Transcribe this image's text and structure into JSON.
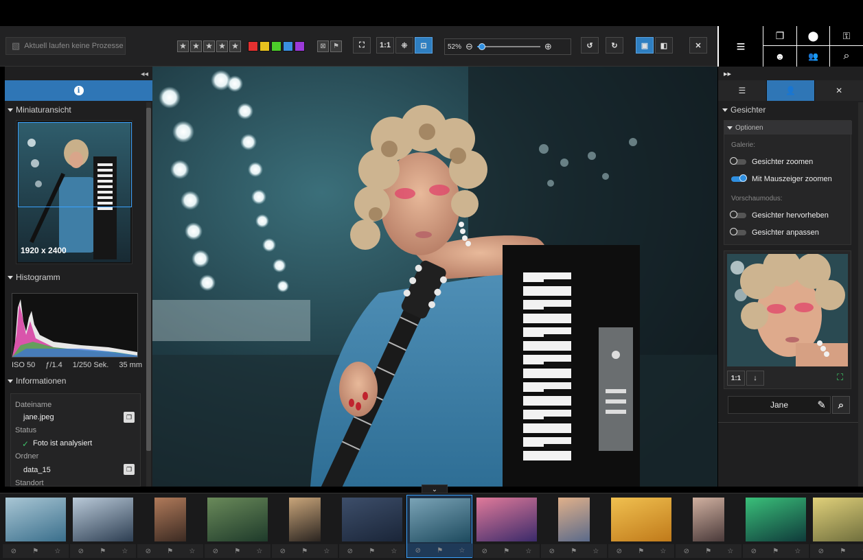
{
  "toolbar": {
    "status_text": "Aktuell laufen keine Prozesse",
    "rating_stars": [
      "★",
      "★",
      "★",
      "★",
      "★"
    ],
    "color_labels": [
      "#e53030",
      "#e8c21e",
      "#4ccd2a",
      "#3a8fe0",
      "#9b3ad8"
    ],
    "view_buttons": [
      "⛶",
      "1:1",
      "⁜",
      "⊡"
    ],
    "zoom_percent": "52%",
    "zoom_level": 0.08,
    "rotate_left": "↺",
    "rotate_right": "↻",
    "layout_single": "▣",
    "layout_compare": "◧",
    "close": "✕"
  },
  "right_cluster": {
    "menu_icon": "≡",
    "stack_icon": "❐",
    "location_icon": "⬤",
    "key_icon": "⚿",
    "face_icon": "☻",
    "people_icon": "👥",
    "search_icon": "⌕"
  },
  "left_panel": {
    "collapse_icon": "◂◂",
    "info_icon": "i",
    "thumbnail_header": "Miniaturansicht",
    "thumbnail_dims": "1920 x 2400",
    "histogram_header": "Histogramm",
    "exif": {
      "iso": "ISO 50",
      "aperture": "ƒ/1.4",
      "shutter": "1/250 Sek.",
      "focal": "35 mm"
    },
    "information_header": "Informationen",
    "info": {
      "filename_label": "Dateiname",
      "filename": "jane.jpeg",
      "status_label": "Status",
      "status_value": "Foto ist analysiert",
      "status_check": "✓",
      "folder_label": "Ordner",
      "folder": "data_15",
      "location_label": "Standort"
    }
  },
  "right_panel": {
    "collapse_icon": "▸▸",
    "tabs": [
      "☰",
      "👤",
      "✕"
    ],
    "faces_header": "Gesichter",
    "options_header": "Optionen",
    "gallery_label": "Galerie:",
    "preview_label": "Vorschaumodus:",
    "toggles": [
      {
        "label": "Gesichter zoomen",
        "on": false
      },
      {
        "label": "Mit Mauszeiger zoomen",
        "on": true
      },
      {
        "label": "Gesichter hervorheben",
        "on": false
      },
      {
        "label": "Gesichter anpassen",
        "on": false
      }
    ],
    "face_ctrl_1to1": "1:1",
    "face_ctrl_down": "↓",
    "face_ctrl_focus": "⛶",
    "person_name": "Jane",
    "edit_icon": "✎",
    "search_icon": "⌕"
  },
  "filmstrip": {
    "toggle_icon": "⌄",
    "bar_icons": [
      "⊘",
      "⚑",
      "☆"
    ],
    "thumbs": [
      {
        "c1": "#3a6f8c",
        "c2": "#a9c6d4"
      },
      {
        "c1": "#2d3e52",
        "c2": "#b9c9d8"
      },
      {
        "c1": "#3b2a22",
        "c2": "#b07a5a"
      },
      {
        "c1": "#1e3a2a",
        "c2": "#6a8a5a"
      },
      {
        "c1": "#2a2420",
        "c2": "#c9a57a"
      },
      {
        "c1": "#1a2538",
        "c2": "#3d4e6a"
      },
      {
        "c1": "#1d4a5e",
        "c2": "#7aa3b6"
      },
      {
        "c1": "#3a2a6a",
        "c2": "#e07a9a"
      },
      {
        "c1": "#5a6a8a",
        "c2": "#e0b08a"
      },
      {
        "c1": "#c07a1a",
        "c2": "#f0c050"
      },
      {
        "c1": "#4a3a3a",
        "c2": "#d0b0a0"
      },
      {
        "c1": "#0f3a3a",
        "c2": "#3ac07a"
      },
      {
        "c1": "#6a6a3a",
        "c2": "#e0d07a"
      }
    ]
  }
}
